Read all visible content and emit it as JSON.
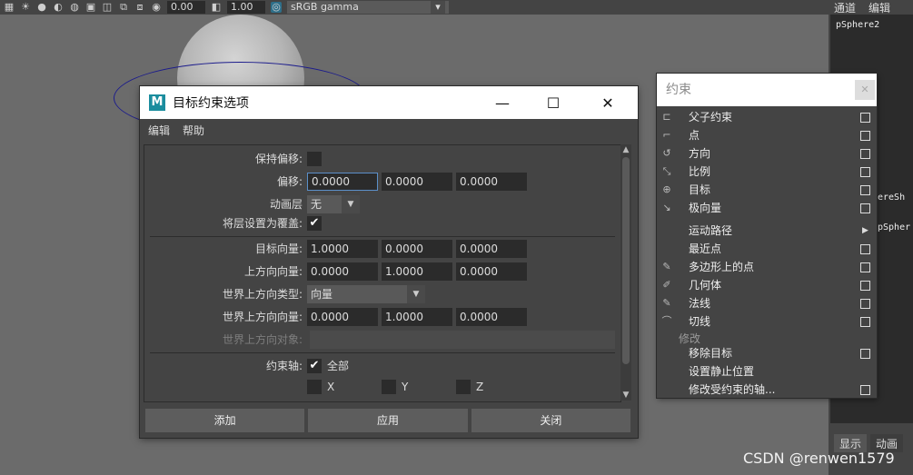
{
  "toolbar": {
    "gamma_value": "0.00",
    "exposure_value": "1.00",
    "color_space": "sRGB gamma"
  },
  "right_panel": {
    "tabs": [
      "通道",
      "编辑"
    ],
    "items": [
      "pSphere2",
      "ereSh",
      "pSpher"
    ],
    "bottom_tabs": [
      "显示",
      "动画"
    ]
  },
  "dialog": {
    "title": "目标约束选项",
    "menu": [
      "编辑",
      "帮助"
    ],
    "keep_offset_label": "保持偏移:",
    "offset_label": "偏移:",
    "offset": [
      "0.0000",
      "0.0000",
      "0.0000"
    ],
    "anim_layer_label": "动画层",
    "anim_layer_value": "无",
    "set_layer_override_label": "将层设置为覆盖:",
    "aim_vector_label": "目标向量:",
    "aim_vector": [
      "1.0000",
      "0.0000",
      "0.0000"
    ],
    "up_vector_label": "上方向向量:",
    "up_vector": [
      "0.0000",
      "1.0000",
      "0.0000"
    ],
    "world_up_type_label": "世界上方向类型:",
    "world_up_type_value": "向量",
    "world_up_vector_label": "世界上方向向量:",
    "world_up_vector": [
      "0.0000",
      "1.0000",
      "0.0000"
    ],
    "world_up_object_label": "世界上方向对象:",
    "constraint_axes_label": "约束轴:",
    "axis_all": "全部",
    "axis_x": "X",
    "axis_y": "Y",
    "axis_z": "Z",
    "buttons": [
      "添加",
      "应用",
      "关闭"
    ]
  },
  "menu": {
    "search_placeholder": "约束",
    "items": [
      "父子约束",
      "点",
      "方向",
      "比例",
      "目标",
      "极向量"
    ],
    "items2": [
      "运动路径",
      "最近点",
      "多边形上的点",
      "几何体",
      "法线",
      "切线"
    ],
    "section_modify": "修改",
    "items3": [
      "移除目标",
      "设置静止位置",
      "修改受约束的轴..."
    ]
  },
  "watermark": "CSDN @renwen1579"
}
